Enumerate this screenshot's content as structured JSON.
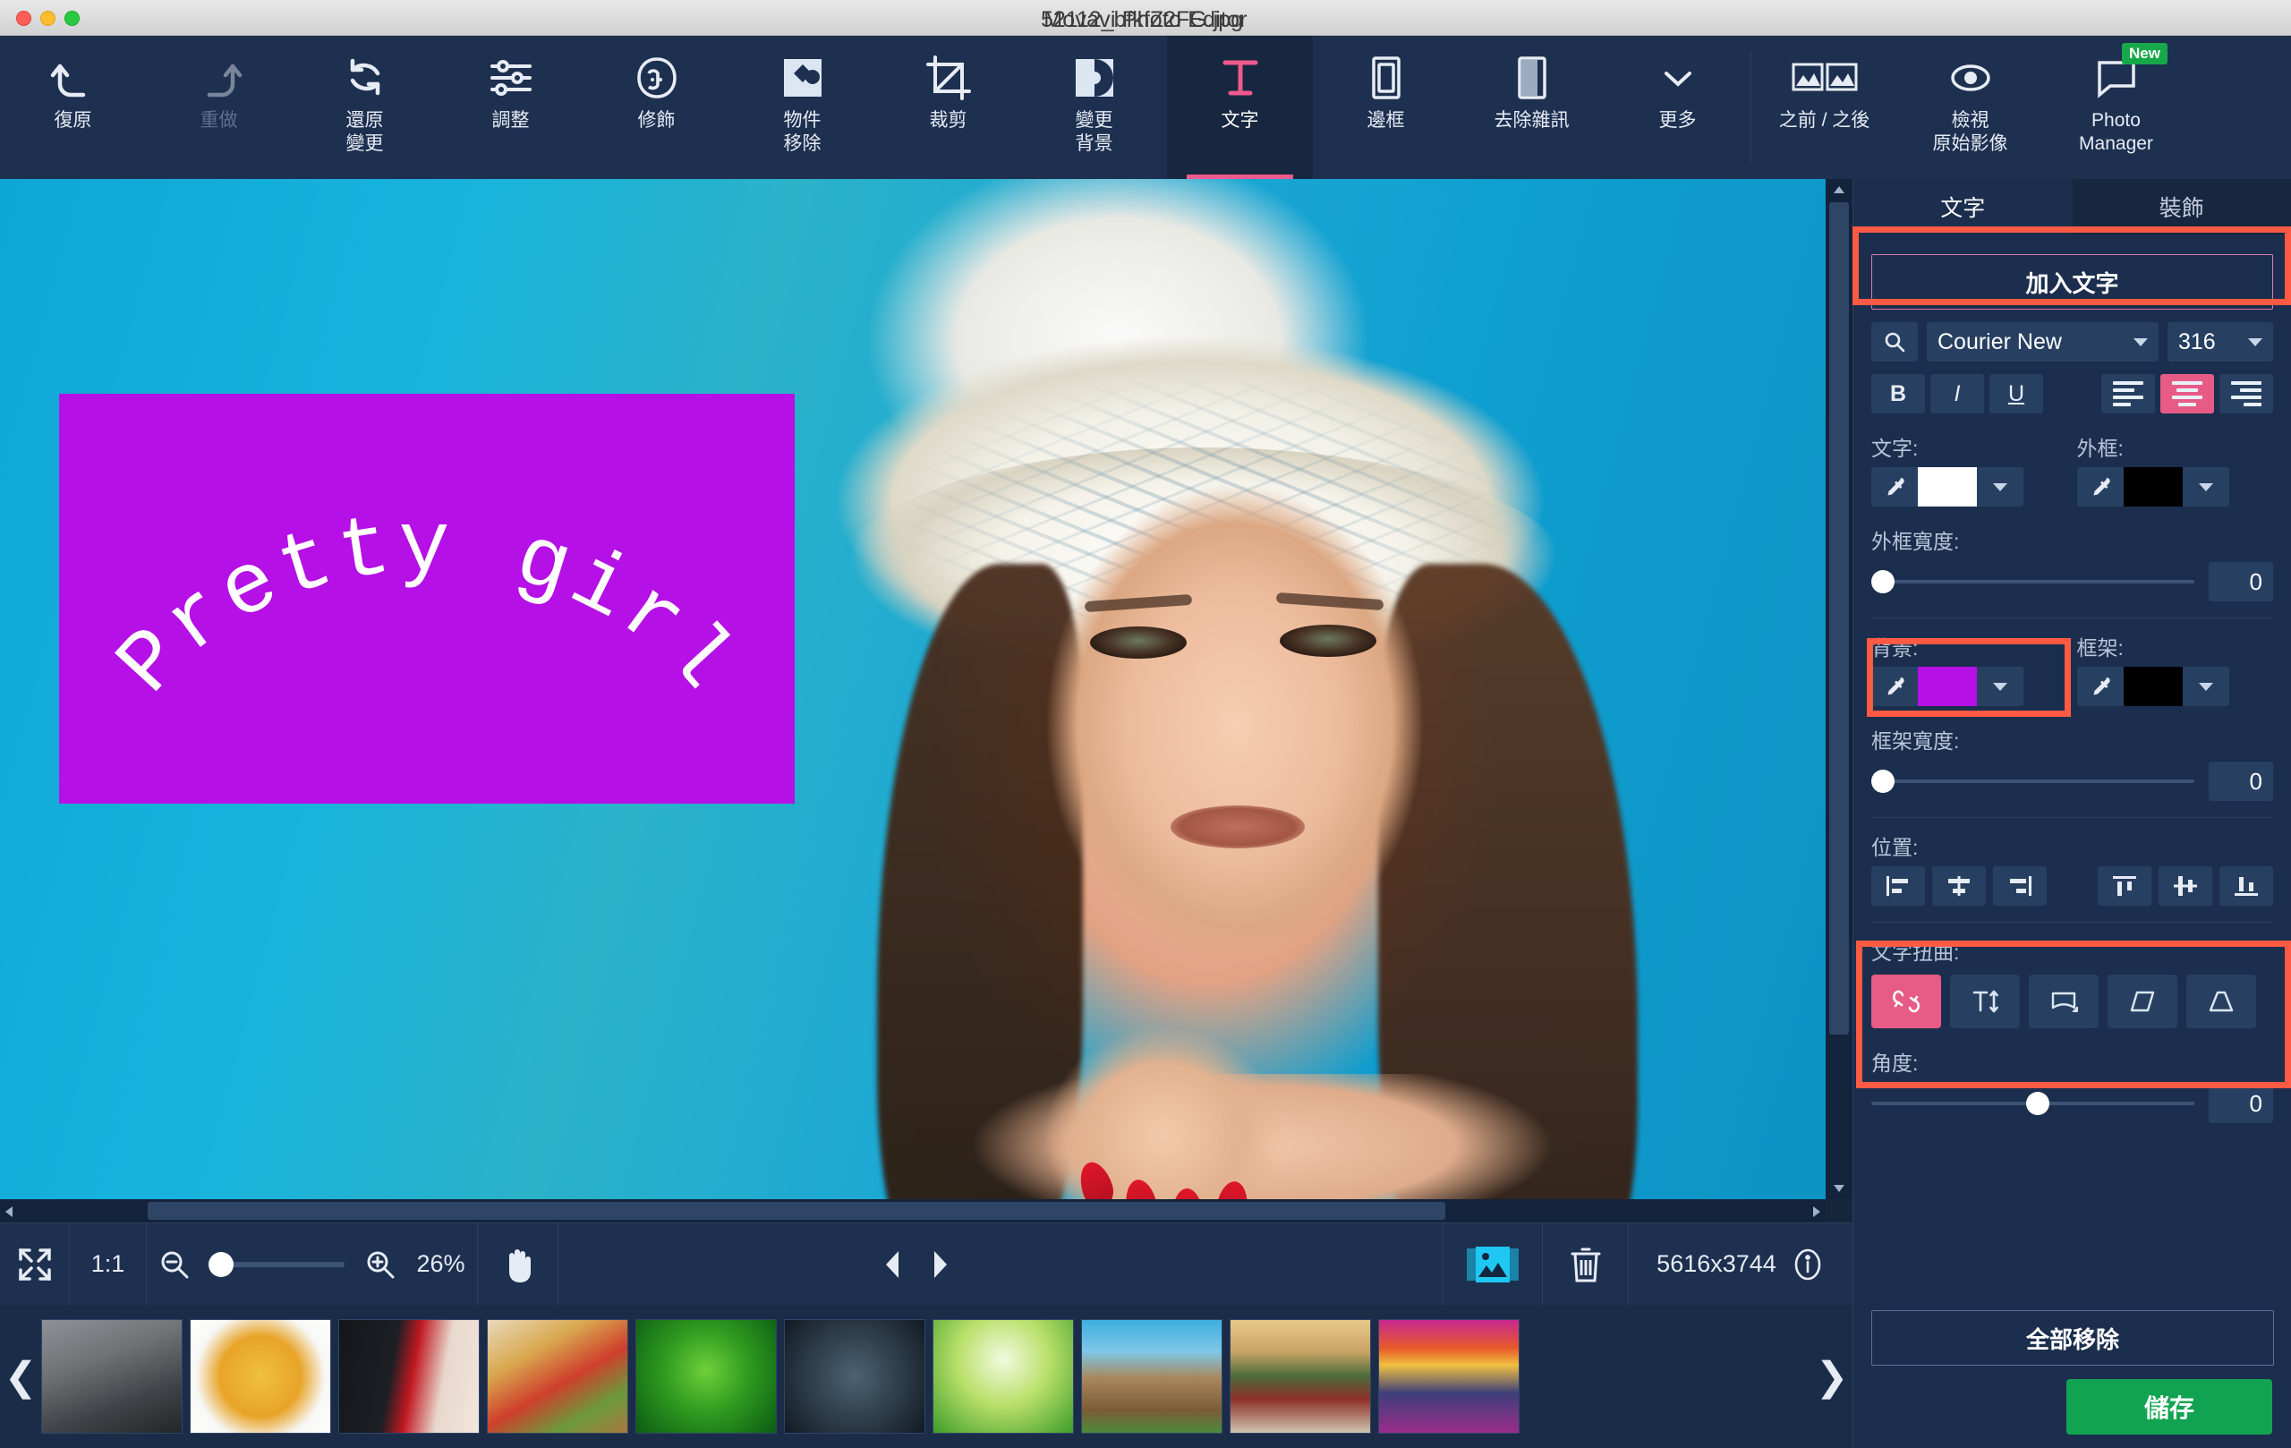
{
  "window": {
    "app_title": "Movavi Photo Editor",
    "file_name": "52112_bfkfZ2FG.jpg"
  },
  "toolbar": {
    "items": [
      {
        "label": "復原",
        "icon": "undo-icon",
        "state": "enabled"
      },
      {
        "label": "重做",
        "icon": "redo-icon",
        "state": "disabled"
      },
      {
        "label": "還原\n變更",
        "icon": "reset-changes-icon",
        "state": "enabled"
      },
      {
        "label": "調整",
        "icon": "adjust-sliders-icon",
        "state": "enabled"
      },
      {
        "label": "修飾",
        "icon": "retouch-face-icon",
        "state": "enabled"
      },
      {
        "label": "物件\n移除",
        "icon": "object-removal-icon",
        "state": "enabled"
      },
      {
        "label": "裁剪",
        "icon": "crop-icon",
        "state": "enabled"
      },
      {
        "label": "變更\n背景",
        "icon": "change-background-icon",
        "state": "enabled"
      },
      {
        "label": "文字",
        "icon": "text-icon",
        "state": "active"
      },
      {
        "label": "邊框",
        "icon": "frame-icon",
        "state": "enabled"
      },
      {
        "label": "去除雜訊",
        "icon": "remove-noise-icon",
        "state": "enabled"
      },
      {
        "label": "更多",
        "icon": "chevron-down-icon",
        "state": "enabled"
      },
      {
        "label": "之前 / 之後",
        "icon": "before-after-icon",
        "state": "enabled"
      },
      {
        "label": "檢視\n原始影像",
        "icon": "view-original-icon",
        "state": "enabled"
      },
      {
        "label": "Photo\nManager",
        "icon": "photo-manager-icon",
        "state": "enabled",
        "badge": "New"
      }
    ]
  },
  "canvas": {
    "overlay_text": "Pretty girl",
    "overlay_text_chars": [
      "P",
      "r",
      "e",
      "t",
      "t",
      "y",
      " ",
      "g",
      "i",
      "r",
      "l"
    ],
    "overlay_background_color": "#b510e6",
    "overlay_text_color": "#ffffff"
  },
  "bottom_bar": {
    "fit_label": "fit-screen-icon",
    "actual_size_label": "1:1",
    "zoom_out_icon": "zoom-out-icon",
    "zoom_in_icon": "zoom-in-icon",
    "zoom_percent": "26%",
    "hand_tool_icon": "hand-tool-icon",
    "prev_icon": "previous-image-icon",
    "next_icon": "next-image-icon",
    "compare_icon": "image-stack-icon",
    "delete_icon": "trash-icon",
    "image_dimensions": "5616x3744",
    "info_icon": "info-icon"
  },
  "filmstrip": {
    "prev_arrow": "chevron-left-icon",
    "next_arrow": "chevron-right-icon",
    "thumbnails": [
      {
        "name": "thumb-workout"
      },
      {
        "name": "thumb-pasta"
      },
      {
        "name": "thumb-roses"
      },
      {
        "name": "thumb-groceries"
      },
      {
        "name": "thumb-green-drops"
      },
      {
        "name": "thumb-boxing"
      },
      {
        "name": "thumb-green-leaves"
      },
      {
        "name": "thumb-temple-ruins"
      },
      {
        "name": "thumb-pagoda"
      },
      {
        "name": "thumb-sunset-flowers"
      }
    ]
  },
  "panel": {
    "tabs": [
      {
        "label": "文字",
        "active": true
      },
      {
        "label": "裝飾",
        "active": false
      }
    ],
    "add_text_button": "加入文字",
    "font": {
      "search_icon": "search-icon",
      "family": "Courier New",
      "size": "316"
    },
    "style": {
      "bold": "B",
      "italic": "I",
      "underline": "U"
    },
    "alignment": {
      "left": "align-left-icon",
      "center": "align-center-icon",
      "right": "align-right-icon",
      "selected": "center"
    },
    "text_color": {
      "label": "文字:",
      "value": "#ffffff",
      "eyedropper": "eyedropper-icon"
    },
    "outline_color": {
      "label": "外框:",
      "value": "#000000",
      "eyedropper": "eyedropper-icon"
    },
    "outline_width": {
      "label": "外框寬度:",
      "value": "0",
      "knob_percent": 0
    },
    "background_color": {
      "label": "背景:",
      "value": "#b510e6",
      "eyedropper": "eyedropper-icon"
    },
    "frame_color": {
      "label": "框架:",
      "value": "#000000",
      "eyedropper": "eyedropper-icon"
    },
    "frame_width": {
      "label": "框架寬度:",
      "value": "0",
      "knob_percent": 0
    },
    "position": {
      "label": "位置:",
      "buttons": [
        "align-horizontal-left-icon",
        "align-horizontal-center-icon",
        "align-horizontal-right-icon",
        "align-vertical-top-icon",
        "align-vertical-middle-icon",
        "align-vertical-bottom-icon"
      ]
    },
    "distortion": {
      "label": "文字扭曲:",
      "buttons": [
        {
          "name": "circle-warp-icon",
          "selected": true
        },
        {
          "name": "stretch-vertical-icon",
          "selected": false
        },
        {
          "name": "arch-warp-icon",
          "selected": false
        },
        {
          "name": "skew-warp-icon",
          "selected": false
        },
        {
          "name": "trapezoid-warp-icon",
          "selected": false
        }
      ]
    },
    "angle": {
      "label": "角度:",
      "value": "0",
      "knob_percent": 50
    },
    "remove_all_button": "全部移除",
    "save_button": "儲存"
  },
  "colors": {
    "panel_bg": "#1c2e4d",
    "toolbar_bg": "#1e3050",
    "accent_pink": "#e75b87",
    "save_green": "#12a352",
    "annotation_red": "#ff5a43"
  }
}
